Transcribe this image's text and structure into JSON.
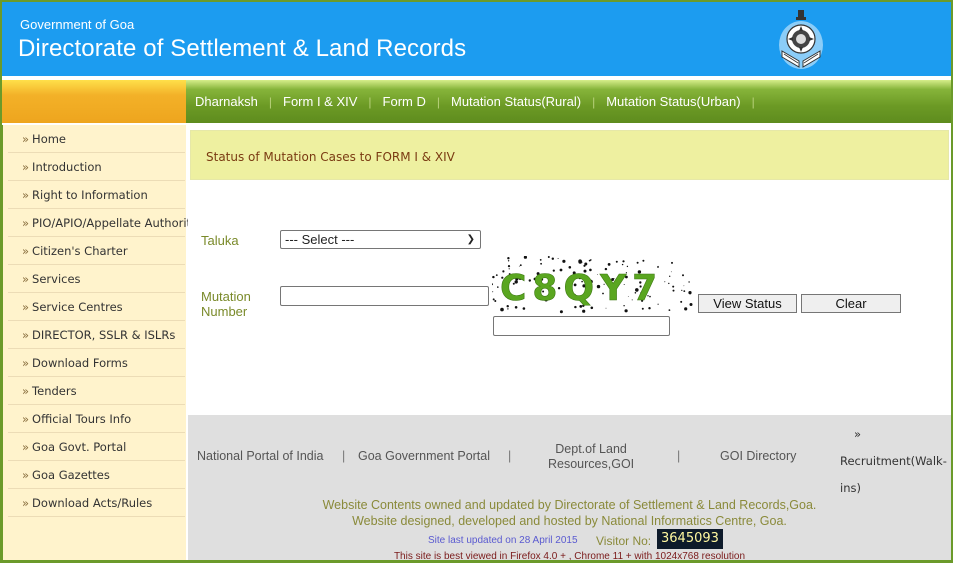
{
  "header": {
    "government": "Government of Goa",
    "title": "Directorate of Settlement & Land Records",
    "emblem": "goa-emblem-icon"
  },
  "nav": {
    "items": [
      {
        "label": "Dharnaksh"
      },
      {
        "label": "Form I & XIV"
      },
      {
        "label": "Form D"
      },
      {
        "label": "Mutation Status(Rural)"
      },
      {
        "label": "Mutation Status(Urban)"
      }
    ],
    "separator": "|"
  },
  "sidebar": {
    "bullet": "»",
    "items": [
      {
        "label": "Home"
      },
      {
        "label": "Introduction"
      },
      {
        "label": "Right to Information"
      },
      {
        "label": "PIO/APIO/Appellate Authority"
      },
      {
        "label": "Citizen's Charter"
      },
      {
        "label": "Services"
      },
      {
        "label": "Service Centres"
      },
      {
        "label": "DIRECTOR, SSLR & ISLRs"
      },
      {
        "label": "Download Forms"
      },
      {
        "label": "Tenders"
      },
      {
        "label": "Official Tours Info"
      },
      {
        "label": "Goa Govt. Portal"
      },
      {
        "label": "Goa Gazettes"
      },
      {
        "label": "Download Acts/Rules"
      }
    ]
  },
  "main": {
    "status_heading": "Status of Mutation Cases to FORM I & XIV",
    "taluka_label": "Taluka",
    "taluka_selected": "--- Select ---",
    "mutation_label_line1": "Mutation",
    "mutation_label_line2": "Number",
    "mutation_value": "",
    "captcha_text": "C8QY7",
    "captcha_input_value": "",
    "view_status_button": "View Status",
    "clear_button": "Clear"
  },
  "footer": {
    "links": [
      {
        "label": "National Portal of India"
      },
      {
        "label": "Goa Government Portal"
      },
      {
        "label": "Dept.of Land"
      },
      {
        "label": "Resources,GOI"
      },
      {
        "label": "GOI Directory"
      }
    ],
    "separator": "|",
    "recruitment_bullet": "»",
    "recruitment_line1": "Recruitment(Walk-",
    "recruitment_line2": "ins)",
    "credit_line1": "Website Contents owned and updated by Directorate of Settlement & Land Records,Goa.",
    "credit_line2": "Website designed, developed and hosted by National Informatics Centre, Goa.",
    "last_updated": "Site last updated on 28 April 2015",
    "visitor_label": "Visitor No:",
    "visitor_count": "3645093",
    "best_viewed": "This site is best viewed in Firefox 4.0 + , Chrome 11 + with 1024x768 resolution"
  },
  "colors": {
    "header_blue": "#1c9cf0",
    "nav_green": "#6c9a25",
    "nav_orange": "#eea51e",
    "sidebar_bg": "#fff3cc",
    "status_bg": "#eef0a0",
    "captcha_green": "#5aa620"
  }
}
